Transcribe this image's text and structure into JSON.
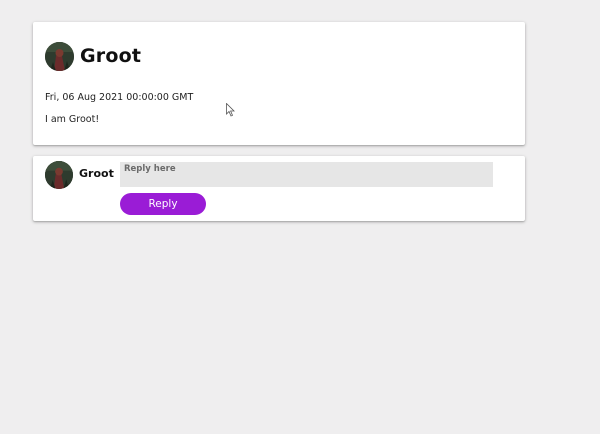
{
  "post": {
    "author": "Groot",
    "date": "Fri, 06 Aug 2021 00:00:00 GMT",
    "body": "I am Groot!",
    "avatar_icon": "groot-avatar-icon"
  },
  "reply": {
    "author": "Groot",
    "placeholder": "Reply here",
    "button_label": "Reply",
    "button_color": "#9a1cd6",
    "avatar_icon": "groot-avatar-icon"
  },
  "cursor_icon": "mouse-pointer-icon"
}
